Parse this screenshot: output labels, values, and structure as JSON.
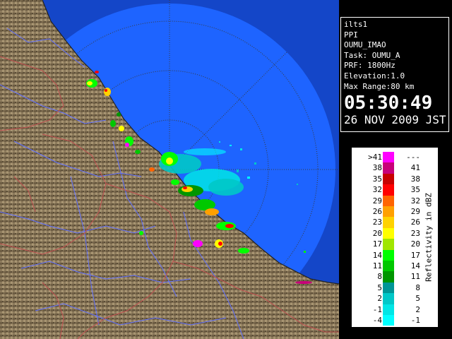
{
  "info": {
    "site": "ilts1",
    "product": "PPI",
    "station": "OUMU_IMAO",
    "task": "Task: OUMU_A",
    "prf": "PRF: 1800Hz",
    "elevation": "Elevation:1.0",
    "max_range": "Max Range:80 km",
    "time": "05:30:49",
    "date": "26 NOV 2009 JST"
  },
  "legend": {
    "label": "Reflectivity in dBZ",
    "rows": [
      {
        "lo": ">41",
        "hi": "---",
        "color": "#ff00ff"
      },
      {
        "lo": "38",
        "hi": "41",
        "color": "#c8007a"
      },
      {
        "lo": "35",
        "hi": "38",
        "color": "#c80000"
      },
      {
        "lo": "32",
        "hi": "35",
        "color": "#ff0000"
      },
      {
        "lo": "29",
        "hi": "32",
        "color": "#ff6400"
      },
      {
        "lo": "26",
        "hi": "29",
        "color": "#ffa000"
      },
      {
        "lo": "23",
        "hi": "26",
        "color": "#ffd200"
      },
      {
        "lo": "20",
        "hi": "23",
        "color": "#ffff00"
      },
      {
        "lo": "17",
        "hi": "20",
        "color": "#a0e600"
      },
      {
        "lo": "14",
        "hi": "17",
        "color": "#00ff00"
      },
      {
        "lo": "11",
        "hi": "14",
        "color": "#00c800"
      },
      {
        "lo": "8",
        "hi": "11",
        "color": "#009600"
      },
      {
        "lo": "5",
        "hi": "8",
        "color": "#009696"
      },
      {
        "lo": "2",
        "hi": "5",
        "color": "#00c8c8"
      },
      {
        "lo": "-1",
        "hi": "2",
        "color": "#00e6e6"
      },
      {
        "lo": "-4",
        "hi": "-1",
        "color": "#00ffff"
      }
    ]
  },
  "colors": {
    "sea": "#1e64ff",
    "outer_sea": "#1446c8",
    "land": "#8c7a5c",
    "river": "#6070ff",
    "border": "#c05050",
    "range_ring": "#3a3a3a"
  }
}
